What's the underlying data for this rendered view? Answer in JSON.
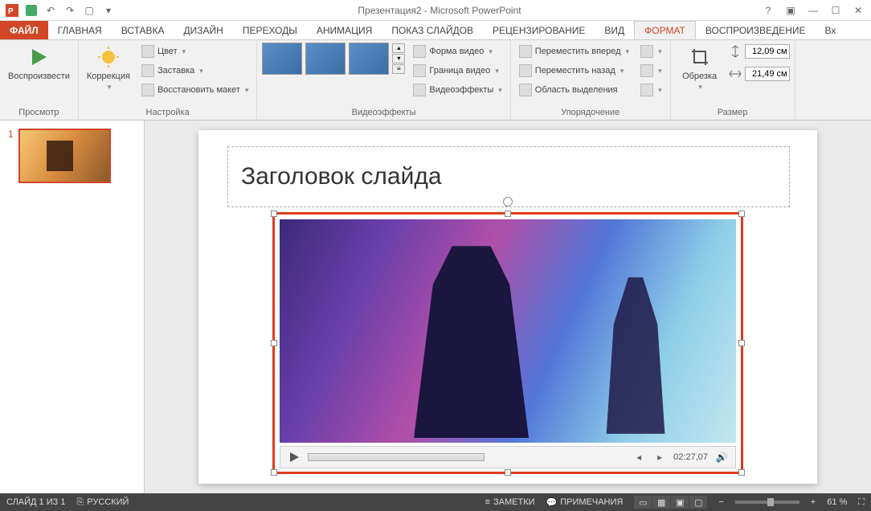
{
  "app": {
    "title": "Презентация2 - Microsoft PowerPoint"
  },
  "tabs": {
    "file": "ФАЙЛ",
    "home": "ГЛАВНАЯ",
    "insert": "ВСТАВКА",
    "design": "ДИЗАЙН",
    "transitions": "ПЕРЕХОДЫ",
    "animations": "АНИМАЦИЯ",
    "slideshow": "ПОКАЗ СЛАЙДОВ",
    "review": "РЕЦЕНЗИРОВАНИЕ",
    "view": "ВИД",
    "format": "ФОРМАТ",
    "playback": "ВОСПРОИЗВЕДЕНИЕ",
    "overflow": "Вх"
  },
  "ribbon": {
    "preview": {
      "label": "Просмотр",
      "play": "Воспроизвести"
    },
    "adjust": {
      "label": "Настройка",
      "corrections": "Коррекция",
      "color": "Цвет",
      "poster": "Заставка",
      "reset": "Восстановить макет"
    },
    "styles": {
      "label": "Видеоэффекты",
      "shape": "Форма видео",
      "border": "Граница видео",
      "effects": "Видеоэффекты"
    },
    "arrange": {
      "label": "Упорядочение",
      "forward": "Переместить вперед",
      "backward": "Переместить назад",
      "selection": "Область выделения"
    },
    "size": {
      "label": "Размер",
      "crop": "Обрезка",
      "height": "12,09 см",
      "width": "21,49 см"
    }
  },
  "thumb": {
    "num": "1"
  },
  "slide": {
    "title": "Заголовок слайда"
  },
  "player": {
    "time": "02:27,07"
  },
  "status": {
    "slide": "СЛАЙД 1 ИЗ 1",
    "lang": "РУССКИЙ",
    "notes": "ЗАМЕТКИ",
    "comments": "ПРИМЕЧАНИЯ",
    "zoom": "61 %"
  }
}
